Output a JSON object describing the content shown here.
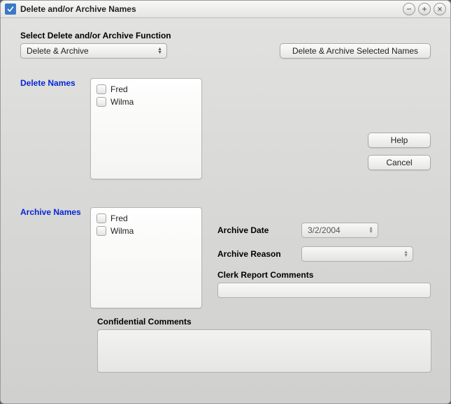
{
  "window": {
    "title": "Delete and/or Archive Names"
  },
  "labels": {
    "select_function": "Select Delete and/or Archive Function",
    "delete_names": "Delete Names",
    "archive_names": "Archive Names",
    "archive_date": "Archive Date",
    "archive_reason": "Archive Reason",
    "clerk_report_comments": "Clerk Report Comments",
    "confidential_comments": "Confidential Comments"
  },
  "dropdown": {
    "value": "Delete & Archive"
  },
  "buttons": {
    "primary": "Delete & Archive Selected Names",
    "help": "Help",
    "cancel": "Cancel"
  },
  "delete_list": {
    "items": [
      "Fred",
      "Wilma"
    ]
  },
  "archive_list": {
    "items": [
      "Fred",
      "Wilma"
    ]
  },
  "fields": {
    "archive_date": "3/2/2004",
    "archive_reason": "",
    "clerk_report_comments": "",
    "confidential_comments": ""
  }
}
